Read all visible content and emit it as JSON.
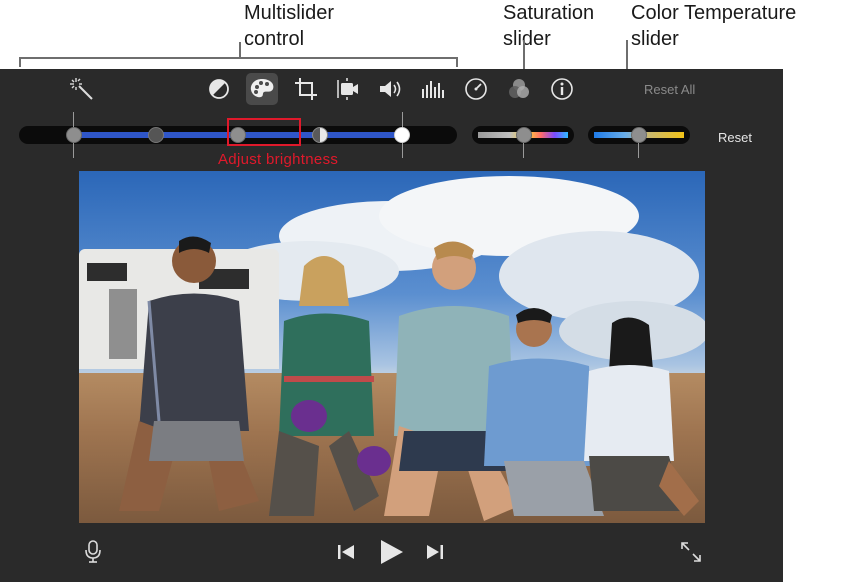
{
  "callouts": {
    "multislider": "Multislider\ncontrol",
    "saturation": "Saturation\nslider",
    "color_temp": "Color Temperature\nslider"
  },
  "toolbar": {
    "tools": [
      "magic-wand",
      "color-balance",
      "color-correction",
      "crop",
      "stabilization",
      "volume",
      "noise-reduction",
      "speed",
      "clip-filter",
      "clip-info"
    ],
    "selected": "color-correction",
    "reset_all_label": "Reset All",
    "reset_label": "Reset"
  },
  "annotation": {
    "highlight_label": "Adjust brightness"
  },
  "playback": {
    "controls": [
      "mic",
      "skip-back",
      "play",
      "skip-forward",
      "fullscreen"
    ]
  },
  "colors": {
    "panel_bg": "#2a2a2a",
    "slider_blue": "#2f56c8",
    "highlight_red": "#e0192b"
  }
}
